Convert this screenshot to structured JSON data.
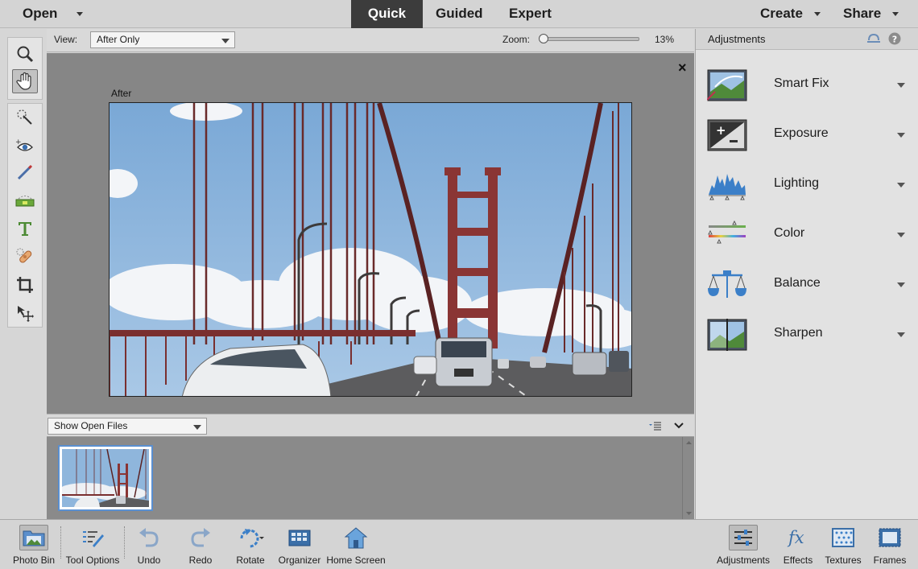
{
  "topbar": {
    "open_label": "Open",
    "modes": [
      "Quick",
      "Guided",
      "Expert"
    ],
    "create_label": "Create",
    "share_label": "Share"
  },
  "options": {
    "view_label": "View:",
    "view_value": "After Only",
    "zoom_label": "Zoom:",
    "zoom_value": "13%",
    "zoom_level": 0.0
  },
  "canvas": {
    "after_label": "After",
    "close_glyph": "×"
  },
  "bin": {
    "source_value": "Show Open Files"
  },
  "panel": {
    "title": "Adjustments",
    "items": [
      {
        "label": "Smart Fix",
        "icon": "smart-fix-icon"
      },
      {
        "label": "Exposure",
        "icon": "exposure-icon"
      },
      {
        "label": "Lighting",
        "icon": "lighting-icon"
      },
      {
        "label": "Color",
        "icon": "color-icon"
      },
      {
        "label": "Balance",
        "icon": "balance-icon"
      },
      {
        "label": "Sharpen",
        "icon": "sharpen-icon"
      }
    ]
  },
  "bottom": {
    "left": [
      {
        "label": "Photo Bin",
        "icon": "photo-bin-icon"
      },
      {
        "label": "Tool Options",
        "icon": "tool-options-icon"
      },
      {
        "label": "Undo",
        "icon": "undo-icon"
      },
      {
        "label": "Redo",
        "icon": "redo-icon"
      },
      {
        "label": "Rotate",
        "icon": "rotate-icon"
      },
      {
        "label": "Organizer",
        "icon": "organizer-icon"
      },
      {
        "label": "Home Screen",
        "icon": "home-icon"
      }
    ],
    "right": [
      {
        "label": "Adjustments",
        "icon": "adjustments-icon"
      },
      {
        "label": "Effects",
        "icon": "effects-icon"
      },
      {
        "label": "Textures",
        "icon": "textures-icon"
      },
      {
        "label": "Frames",
        "icon": "frames-icon"
      }
    ]
  },
  "colors": {
    "accent_active": "#3c3c3c",
    "sky": "#8fb9de",
    "bridge": "#7a2f2f"
  }
}
